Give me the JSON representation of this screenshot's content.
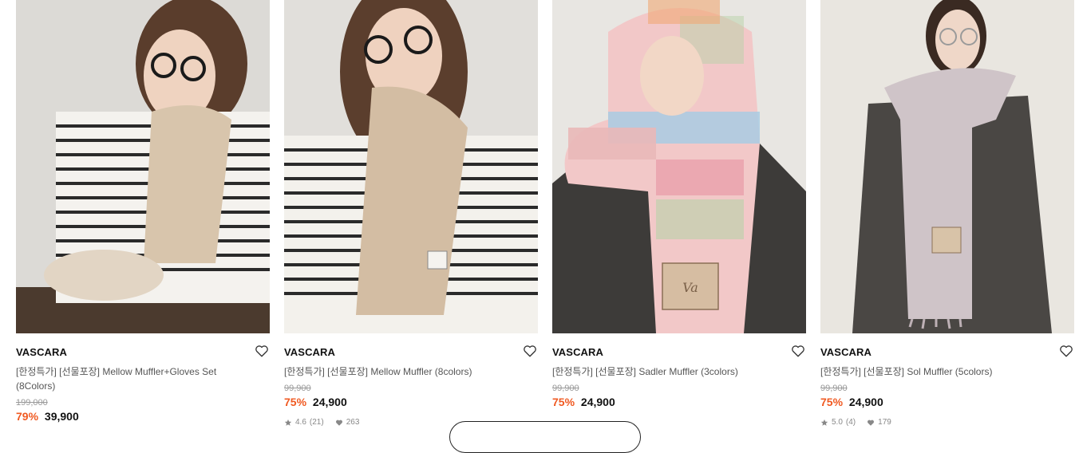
{
  "products": [
    {
      "brand": "VASCARA",
      "title": "[한정특가] [선물포장] Mellow Muffler+Gloves Set (8Colors)",
      "original_price": "199,000",
      "discount": "79%",
      "price": "39,900",
      "rating": "",
      "review_count": "",
      "likes": ""
    },
    {
      "brand": "VASCARA",
      "title": "[한정특가] [선물포장] Mellow Muffler (8colors)",
      "original_price": "99,900",
      "discount": "75%",
      "price": "24,900",
      "rating": "4.6",
      "review_count": "(21)",
      "likes": "263"
    },
    {
      "brand": "VASCARA",
      "title": "[한정특가] [선물포장] Sadler Muffler (3colors)",
      "original_price": "99,900",
      "discount": "75%",
      "price": "24,900",
      "rating": "",
      "review_count": "",
      "likes": ""
    },
    {
      "brand": "VASCARA",
      "title": "[한정특가] [선물포장] Sol Muffler (5colors)",
      "original_price": "99,900",
      "discount": "75%",
      "price": "24,900",
      "rating": "5.0",
      "review_count": "(4)",
      "likes": "179"
    }
  ],
  "colors": {
    "discount": "#f05a22",
    "text": "#111111",
    "muted": "#999999"
  },
  "icons": {
    "wishlist": "heart-outline-icon",
    "rating": "star-icon",
    "likes": "heart-filled-icon"
  }
}
